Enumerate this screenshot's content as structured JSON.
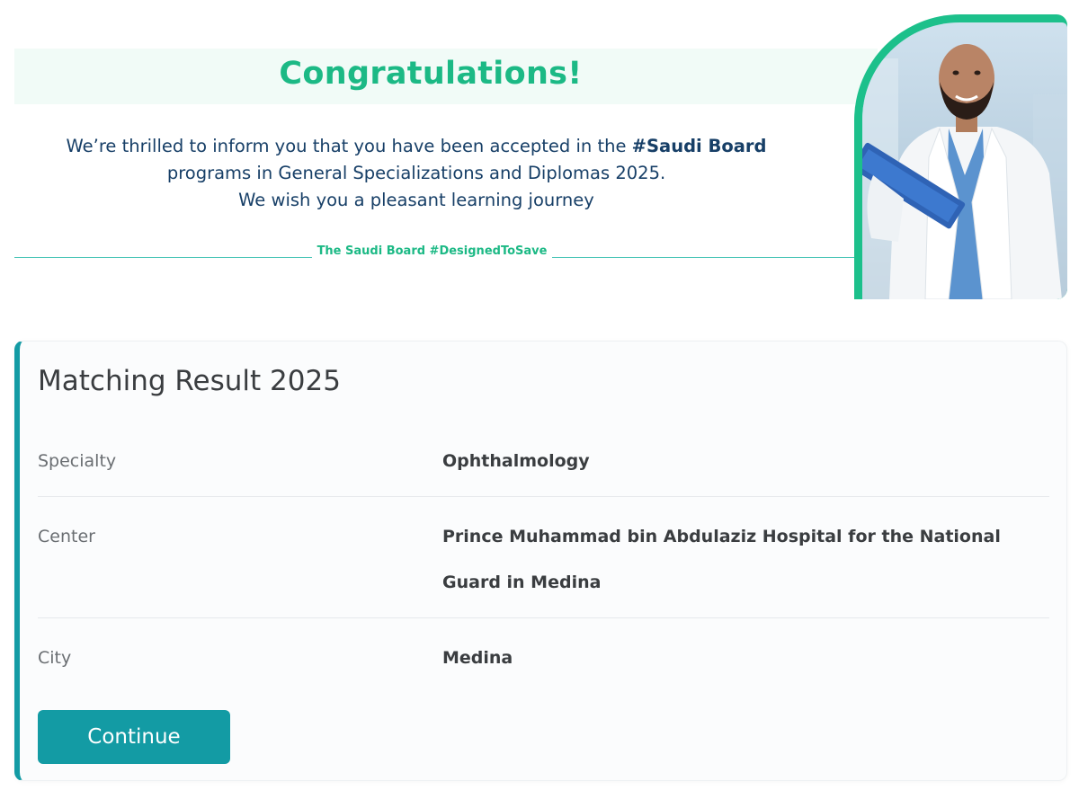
{
  "banner": {
    "title": "Congratulations!",
    "message_line1_prefix": "We’re thrilled to inform you that you have been accepted in the ",
    "message_line1_hashtag": "#Saudi Board",
    "message_line2": "programs in General Specializations and Diplomas 2025.",
    "message_line3": "We wish you a pleasant learning journey",
    "tagline": "The Saudi Board #DesignedToSave"
  },
  "result": {
    "title": "Matching Result 2025",
    "rows": [
      {
        "label": "Specialty",
        "value": "Ophthalmology"
      },
      {
        "label": "Center",
        "value": "Prince Muhammad bin Abdulaziz Hospital for the National Guard in Medina"
      },
      {
        "label": "City",
        "value": "Medina"
      }
    ],
    "continue_label": "Continue"
  },
  "colors": {
    "brand_green": "#1cb985",
    "brand_teal": "#139ba4",
    "navy_text": "#173f67"
  }
}
